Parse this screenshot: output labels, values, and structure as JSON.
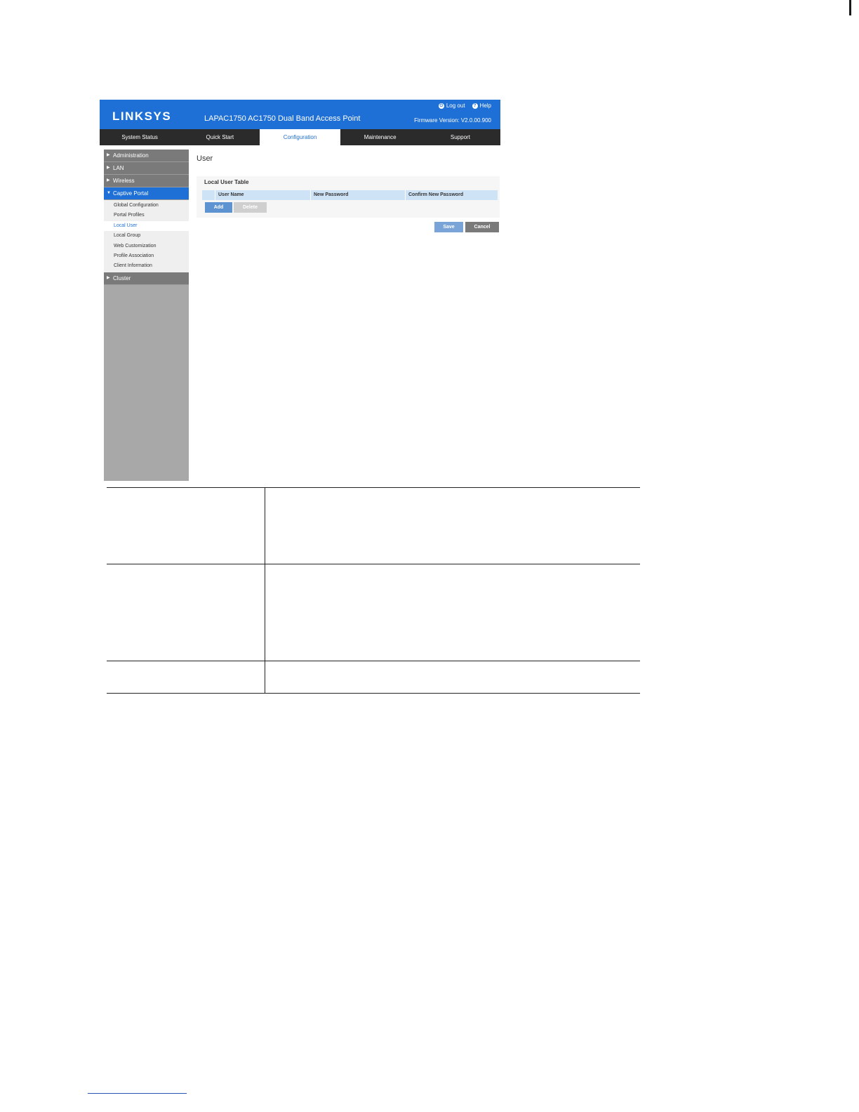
{
  "header": {
    "logo": "LINKSYS",
    "device_title": "LAPAC1750 AC1750 Dual Band Access Point",
    "logout_label": "Log out",
    "help_label": "Help",
    "firmware": "Firmware Version: V2.0.00.900"
  },
  "nav": {
    "tabs": [
      {
        "label": "System Status"
      },
      {
        "label": "Quick Start"
      },
      {
        "label": "Configuration"
      },
      {
        "label": "Maintenance"
      },
      {
        "label": "Support"
      }
    ]
  },
  "sidebar": {
    "items": [
      {
        "label": "Administration"
      },
      {
        "label": "LAN"
      },
      {
        "label": "Wireless"
      },
      {
        "label": "Captive Portal"
      },
      {
        "label": "Cluster"
      }
    ],
    "sub_items": [
      {
        "label": "Global Configuration"
      },
      {
        "label": "Portal Profiles"
      },
      {
        "label": "Local User"
      },
      {
        "label": "Local Group"
      },
      {
        "label": "Web Customization"
      },
      {
        "label": "Profile Association"
      },
      {
        "label": "Client Information"
      }
    ]
  },
  "main": {
    "page_title": "User",
    "panel_title": "Local User Table",
    "columns": [
      "User Name",
      "New Password",
      "Confirm New Password"
    ],
    "add_label": "Add",
    "delete_label": "Delete",
    "save_label": "Save",
    "cancel_label": "Cancel"
  },
  "colors": {
    "brand_blue": "#1e6fd6",
    "nav_dark": "#2b2b2b",
    "sidebar_gray": "#7a7a7a"
  }
}
